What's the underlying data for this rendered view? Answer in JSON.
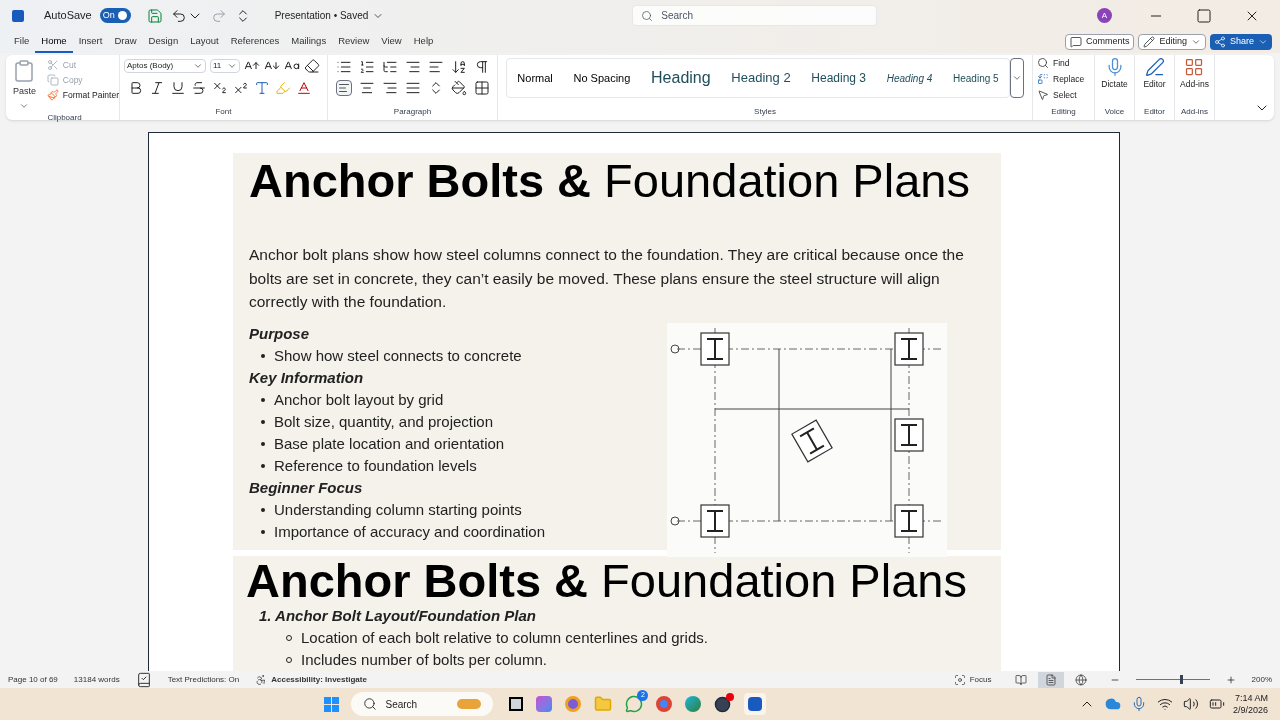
{
  "title_bar": {
    "autosave_label": "AutoSave",
    "autosave_toggle": {
      "label": "On",
      "on": true
    },
    "document_title": "Presentation • Saved",
    "search_placeholder": "Search",
    "avatar": "A"
  },
  "menu_tabs": [
    {
      "label": "File",
      "selected": false
    },
    {
      "label": "Home",
      "selected": true
    },
    {
      "label": "Insert",
      "selected": false
    },
    {
      "label": "Draw",
      "selected": false
    },
    {
      "label": "Design",
      "selected": false
    },
    {
      "label": "Layout",
      "selected": false
    },
    {
      "label": "References",
      "selected": false
    },
    {
      "label": "Mailings",
      "selected": false
    },
    {
      "label": "Review",
      "selected": false
    },
    {
      "label": "View",
      "selected": false
    },
    {
      "label": "Help",
      "selected": false
    }
  ],
  "header_buttons": {
    "comments": "Comments",
    "editing": "Editing",
    "share": "Share"
  },
  "ribbon": {
    "clipboard": {
      "label": "Clipboard",
      "paste": "Paste",
      "cut": {
        "label": "Cut",
        "disabled": true
      },
      "copy": {
        "label": "Copy",
        "disabled": true
      },
      "format_painter": "Format Painter"
    },
    "font": {
      "label": "Font",
      "font_name": "Aptos (Body)",
      "font_size": "11"
    },
    "paragraph": {
      "label": "Paragraph"
    },
    "styles": {
      "label": "Styles",
      "items": [
        {
          "label": "Normal",
          "kind": "normal"
        },
        {
          "label": "No Spacing",
          "kind": "normal"
        },
        {
          "label": "Heading",
          "kind": "heading1"
        },
        {
          "label": "Heading 2",
          "kind": "heading2"
        },
        {
          "label": "Heading 3",
          "kind": "heading3"
        },
        {
          "label": "Heading 4",
          "kind": "heading4"
        },
        {
          "label": "Heading 5",
          "kind": "heading5"
        }
      ]
    },
    "editing": {
      "label": "Editing",
      "find": "Find",
      "replace": "Replace",
      "select": "Select"
    },
    "voice": {
      "label": "Voice",
      "dictate": "Dictate"
    },
    "editor": {
      "label": "Editor",
      "button": "Editor"
    },
    "addins": {
      "label": "Add-ins",
      "button": "Add-ins"
    }
  },
  "document": {
    "slides": [
      {
        "title": "**Anchor Bolts &** Foundation Plans",
        "intro": "Anchor bolt plans show how steel columns connect to the foundation. They are critical because once the bolts are set in concrete, they can’t easily be moved. These plans ensure the steel structure will align correctly with the foundation.",
        "sections": [
          {
            "heading": "Purpose",
            "bullets": [
              "Show how steel connects to concrete"
            ]
          },
          {
            "heading": "Key Information",
            "bullets": [
              "Anchor bolt layout by grid",
              "Bolt size, quantity, and projection",
              "Base plate location and orientation",
              "Reference to foundation levels"
            ]
          },
          {
            "heading": "Beginner Focus",
            "bullets": [
              "Understanding column starting points",
              "Importance of accuracy and coordination"
            ]
          }
        ]
      },
      {
        "title": "**Anchor Bolts &** Foundation Plans",
        "numbered_heading": "1. Anchor Bolt Layout/Foundation Plan",
        "bullets": [
          "Location of each bolt relative to column centerlines and grids.",
          "Includes number of bolts per column."
        ]
      }
    ]
  },
  "status_bar": {
    "page": "Page 10 of 69",
    "words": "13184 words",
    "text_predictions": "Text Predictions: On",
    "accessibility": "Accessibility: Investigate",
    "focus": "Focus",
    "views": [
      {
        "kind": "read",
        "selected": false
      },
      {
        "kind": "print",
        "selected": true
      },
      {
        "kind": "web",
        "selected": false
      }
    ],
    "zoom": {
      "level": 0.6,
      "reading": "200%"
    }
  },
  "taskbar": {
    "search_placeholder": "Search",
    "whatsapp_badge": "2",
    "time": "7:14 AM",
    "date": "2/9/2026"
  }
}
